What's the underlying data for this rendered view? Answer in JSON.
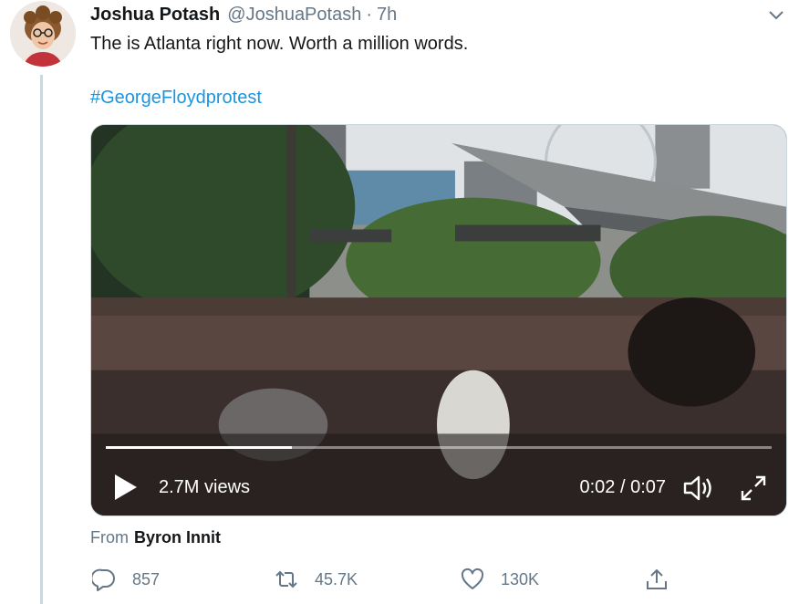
{
  "tweet": {
    "display_name": "Joshua Potash",
    "handle": "@JoshuaPotash",
    "separator": "·",
    "time": "7h",
    "text": "The is Atlanta right now. Worth a million words.",
    "hashtag": "#GeorgeFloydprotest"
  },
  "video": {
    "views": "2.7M views",
    "timecode": "0:02 / 0:07",
    "progress": 0.28
  },
  "attribution": {
    "prefix": "From",
    "name": "Byron Innit"
  },
  "actions": {
    "reply_count": "857",
    "retweet_count": "45.7K",
    "like_count": "130K"
  },
  "colors": {
    "link": "#1b95e0",
    "muted": "#657786",
    "text": "#14171a",
    "thread_line": "#ccd6dd"
  },
  "icons": [
    "caret-down-icon",
    "play-icon",
    "volume-icon",
    "fullscreen-icon",
    "reply-icon",
    "retweet-icon",
    "like-icon",
    "share-icon"
  ]
}
